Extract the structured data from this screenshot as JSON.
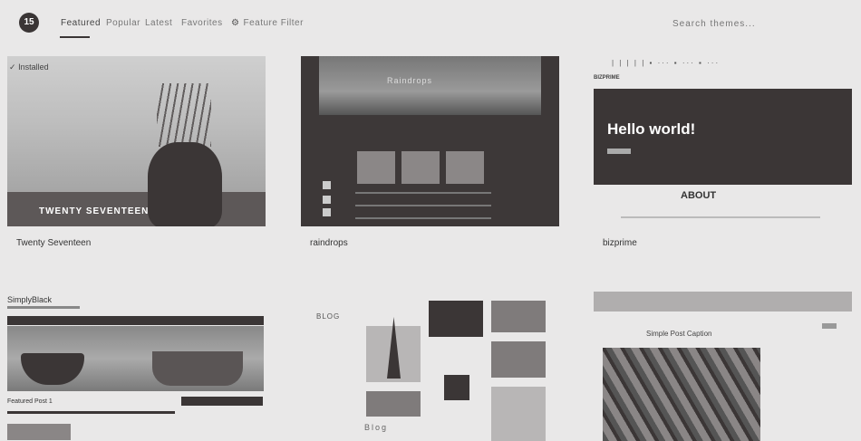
{
  "header": {
    "theme_count": "15",
    "tabs": [
      {
        "label": "Featured"
      },
      {
        "label": "Popular"
      },
      {
        "label": "Latest"
      },
      {
        "label": "Favorites"
      },
      {
        "label": "Feature Filter"
      }
    ],
    "search_placeholder": "Search themes..."
  },
  "themes": [
    {
      "name": "Twenty Seventeen",
      "installed_label": "Installed",
      "screenshot_title": "TWENTY SEVENTEEN"
    },
    {
      "name": "raindrops",
      "screenshot_title": "Raindrops"
    },
    {
      "name": "bizprime",
      "screenshot_logo": "BIZPRIME",
      "hero_text": "Hello world!",
      "about_heading": "ABOUT"
    },
    {
      "name": "",
      "screenshot_title": "SimplyBlack",
      "post_title": "Featured Post 1"
    },
    {
      "name": "",
      "logo_text": "BLOG",
      "footer_text": "Blog"
    },
    {
      "name": "",
      "post_title": "Simple Post Caption"
    }
  ],
  "icons": {
    "gear": "gear-icon",
    "check": "check-icon"
  }
}
